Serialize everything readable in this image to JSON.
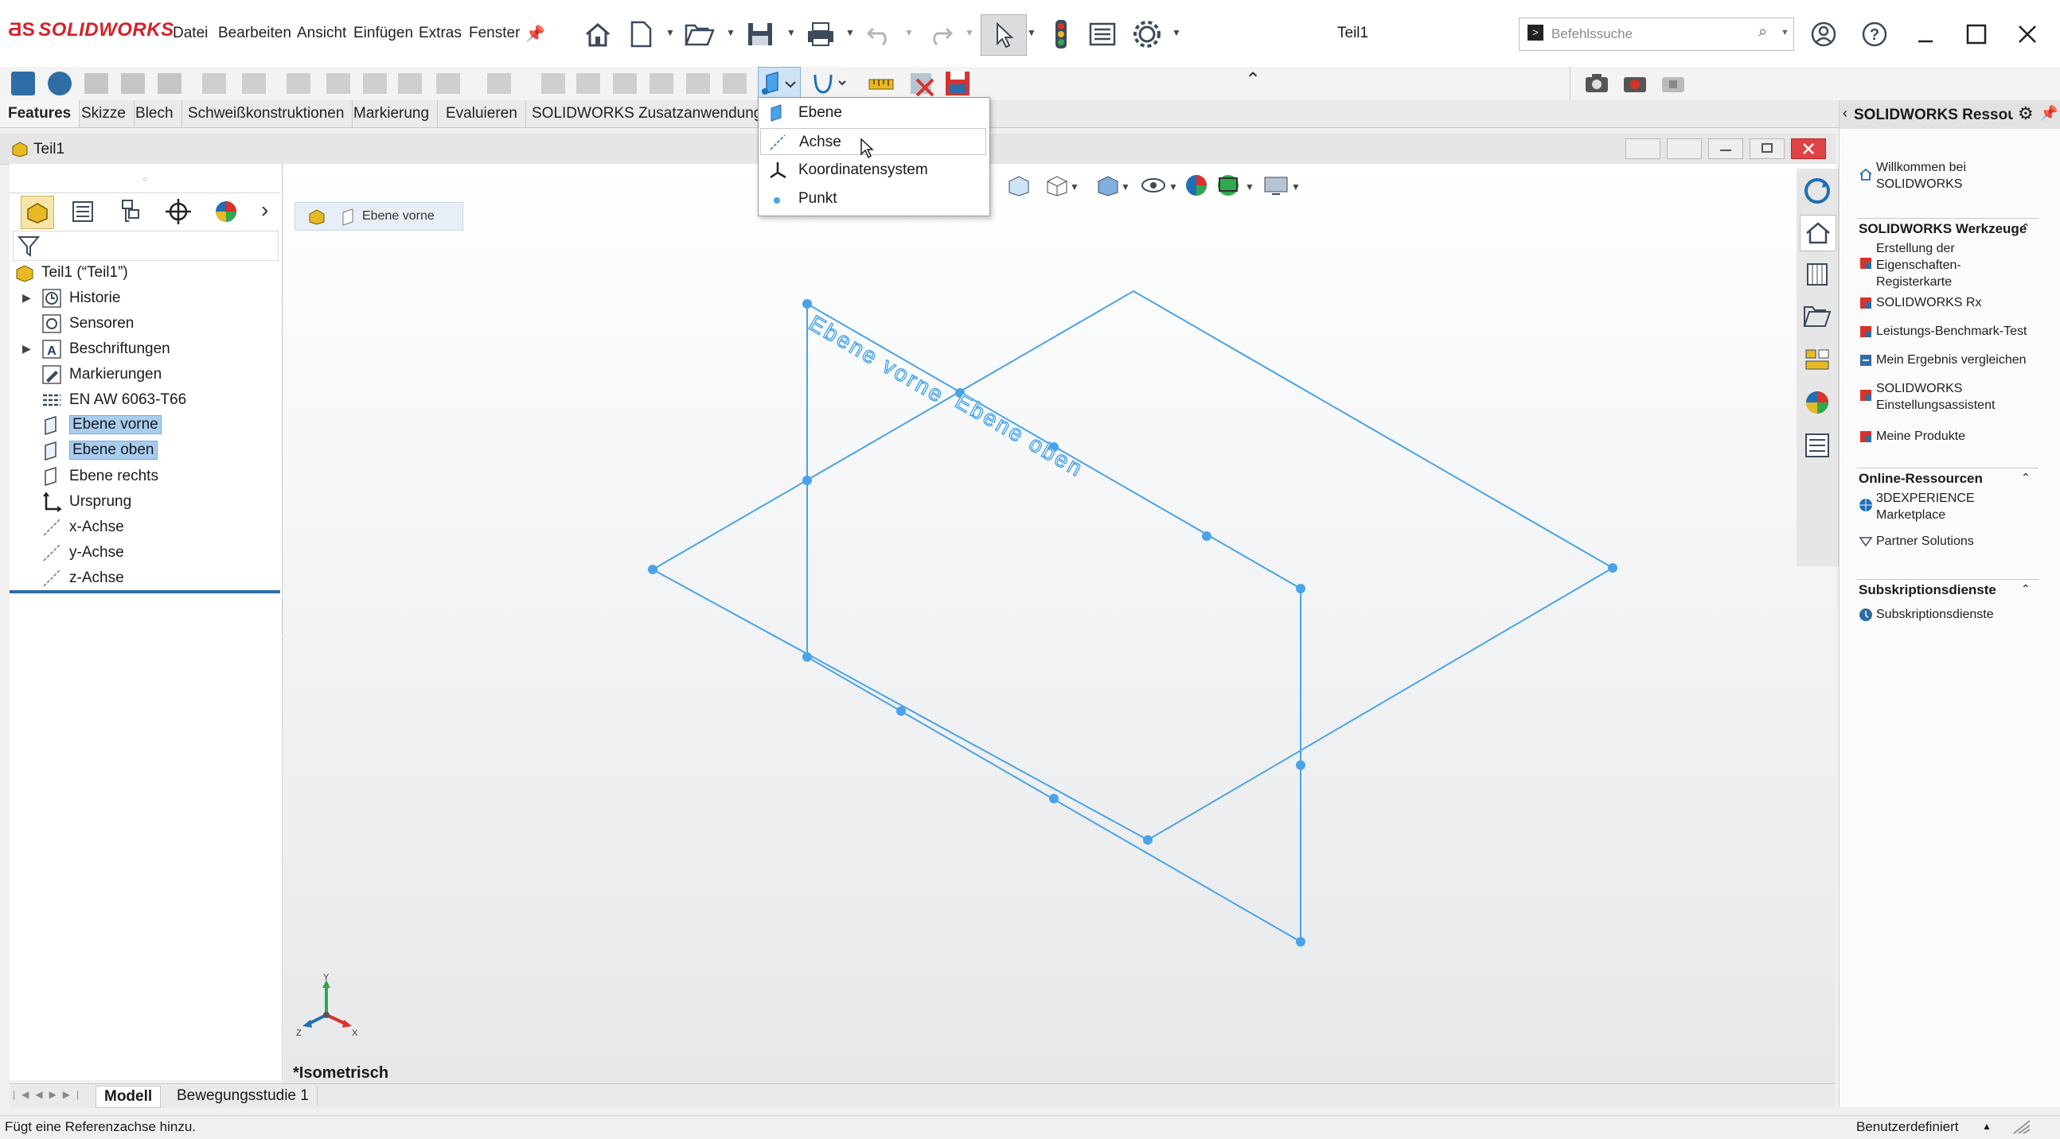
{
  "app": {
    "logo": "SOLIDWORKS",
    "doc_title": "Teil1"
  },
  "menu": [
    "Datei",
    "Bearbeiten",
    "Ansicht",
    "Einfügen",
    "Extras",
    "Fenster"
  ],
  "search": {
    "placeholder": "Befehlssuche"
  },
  "tabs": [
    {
      "label": "Features",
      "active": true
    },
    {
      "label": "Skizze"
    },
    {
      "label": "Blech"
    },
    {
      "label": "Schweißkonstruktionen"
    },
    {
      "label": "Markierung"
    },
    {
      "label": "Evaluieren"
    },
    {
      "label": "SOLIDWORKS Zusatzanwendungen"
    }
  ],
  "dropdown": {
    "items": [
      "Ebene",
      "Achse",
      "Koordinatensystem",
      "Punkt"
    ],
    "hovered": "Achse"
  },
  "docwindow": {
    "title": "Teil1"
  },
  "featuretree": {
    "root": "Teil1 (“Teil1”)",
    "items": [
      {
        "label": "Historie",
        "expandable": true
      },
      {
        "label": "Sensoren"
      },
      {
        "label": "Beschriftungen",
        "expandable": true
      },
      {
        "label": "Markierungen"
      },
      {
        "label": "EN AW 6063-T66"
      },
      {
        "label": "Ebene vorne",
        "selected": true
      },
      {
        "label": "Ebene oben",
        "selected": true
      },
      {
        "label": "Ebene rechts"
      },
      {
        "label": "Ursprung"
      },
      {
        "label": "x-Achse"
      },
      {
        "label": "y-Achse"
      },
      {
        "label": "z-Achse"
      }
    ]
  },
  "viewport": {
    "breadcrumb": "Ebene vorne",
    "plane_label_front": "Ebene vorne",
    "plane_label_top": "Ebene oben",
    "view_name": "*Isometrisch",
    "triad": {
      "y": "Y",
      "x": "X",
      "z": "Z"
    }
  },
  "taskpane": {
    "title": "SOLIDWORKS Ressourcen",
    "welcome": "Willkommen bei SOLIDWORKS",
    "tools_section": "SOLIDWORKS Werkzeuge",
    "tools": [
      "Erstellung der Eigenschaften-Registerkarte",
      "SOLIDWORKS Rx",
      "Leistungs-Benchmark-Test",
      "Mein Ergebnis vergleichen",
      "SOLIDWORKS Einstellungsassistent",
      "Meine Produkte"
    ],
    "online_section": "Online-Ressourcen",
    "online": [
      "3DEXPERIENCE Marketplace",
      "Partner Solutions"
    ],
    "sub_section": "Subskriptionsdienste",
    "sub": [
      "Subskriptionsdienste"
    ]
  },
  "bottomtabs": {
    "model": "Modell",
    "motion": "Bewegungsstudie 1"
  },
  "status": {
    "left": "Fügt eine Referenzachse hinzu.",
    "right": "Benutzerdefiniert"
  },
  "colors": {
    "brand": "#d62027",
    "sketch_blue": "#4aa3e8",
    "selection": "#a9cdf0"
  }
}
